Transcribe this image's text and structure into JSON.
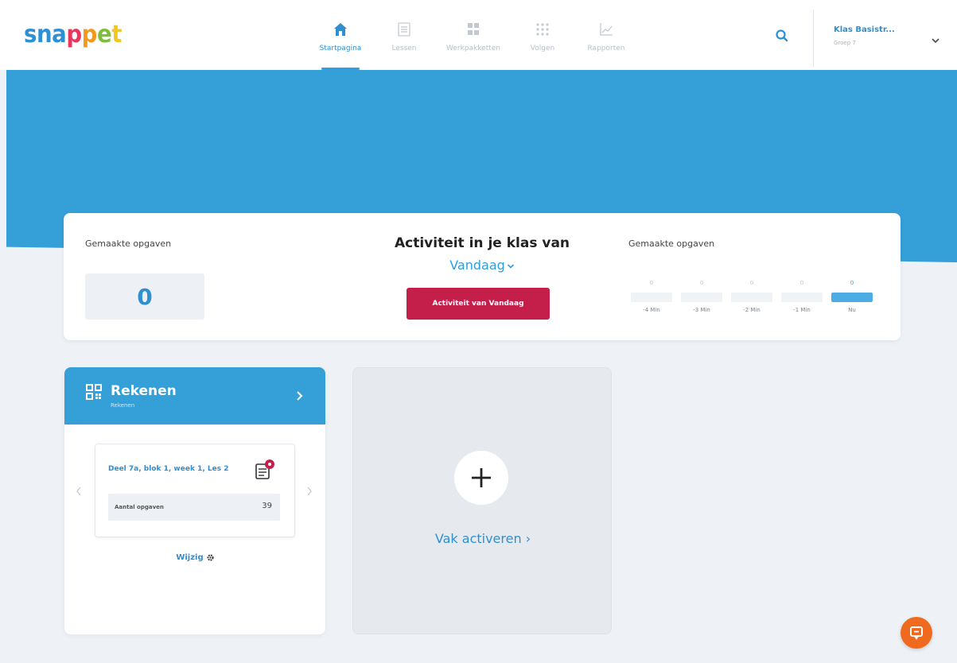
{
  "header": {
    "logo_letters": [
      "s",
      "n",
      "a",
      "p",
      "p",
      "e",
      "t"
    ],
    "logo_colors": [
      "#2d8fd4",
      "#2d8fd4",
      "#2d8fd4",
      "#e8365d",
      "#f29a1d",
      "#7fbd3c",
      "#f2c81d"
    ],
    "nav": [
      {
        "label": "Startpagina",
        "icon": "home-icon",
        "active": true
      },
      {
        "label": "Lessen",
        "icon": "document-list-icon",
        "active": false
      },
      {
        "label": "Werkpakketten",
        "icon": "package-grid-icon",
        "active": false
      },
      {
        "label": "Volgen",
        "icon": "dots-grid-icon",
        "active": false
      },
      {
        "label": "Rapporten",
        "icon": "line-chart-icon",
        "active": false
      }
    ],
    "search_icon": "search-icon",
    "class_name": "Klas Basistr...",
    "class_sub": "Groep 7"
  },
  "activity": {
    "left_label": "Gemaakte opgaven",
    "count": "0",
    "title": "Activiteit in je klas van",
    "period": "Vandaag",
    "button_label": "Activiteit van Vandaag",
    "right_label": "Gemaakte opgaven",
    "chart_data": {
      "type": "bar",
      "categories": [
        "-4 Min",
        "-3 Min",
        "-2 Min",
        "-1 Min",
        "Nu"
      ],
      "values": [
        0,
        0,
        0,
        0,
        0
      ]
    }
  },
  "subject": {
    "title": "Rekenen",
    "subtitle": "Rekenen",
    "lesson_title": "Deel 7a, blok 1, week 1, Les 2",
    "row_label": "Aantal opgaven",
    "row_value": "39",
    "change_label": "Wijzig"
  },
  "activate": {
    "label": "Vak activeren ›"
  },
  "colors": {
    "accent": "#2f9ee0",
    "banner": "#359fd7",
    "button": "#c41e4a",
    "chat": "#ef6a1e"
  }
}
